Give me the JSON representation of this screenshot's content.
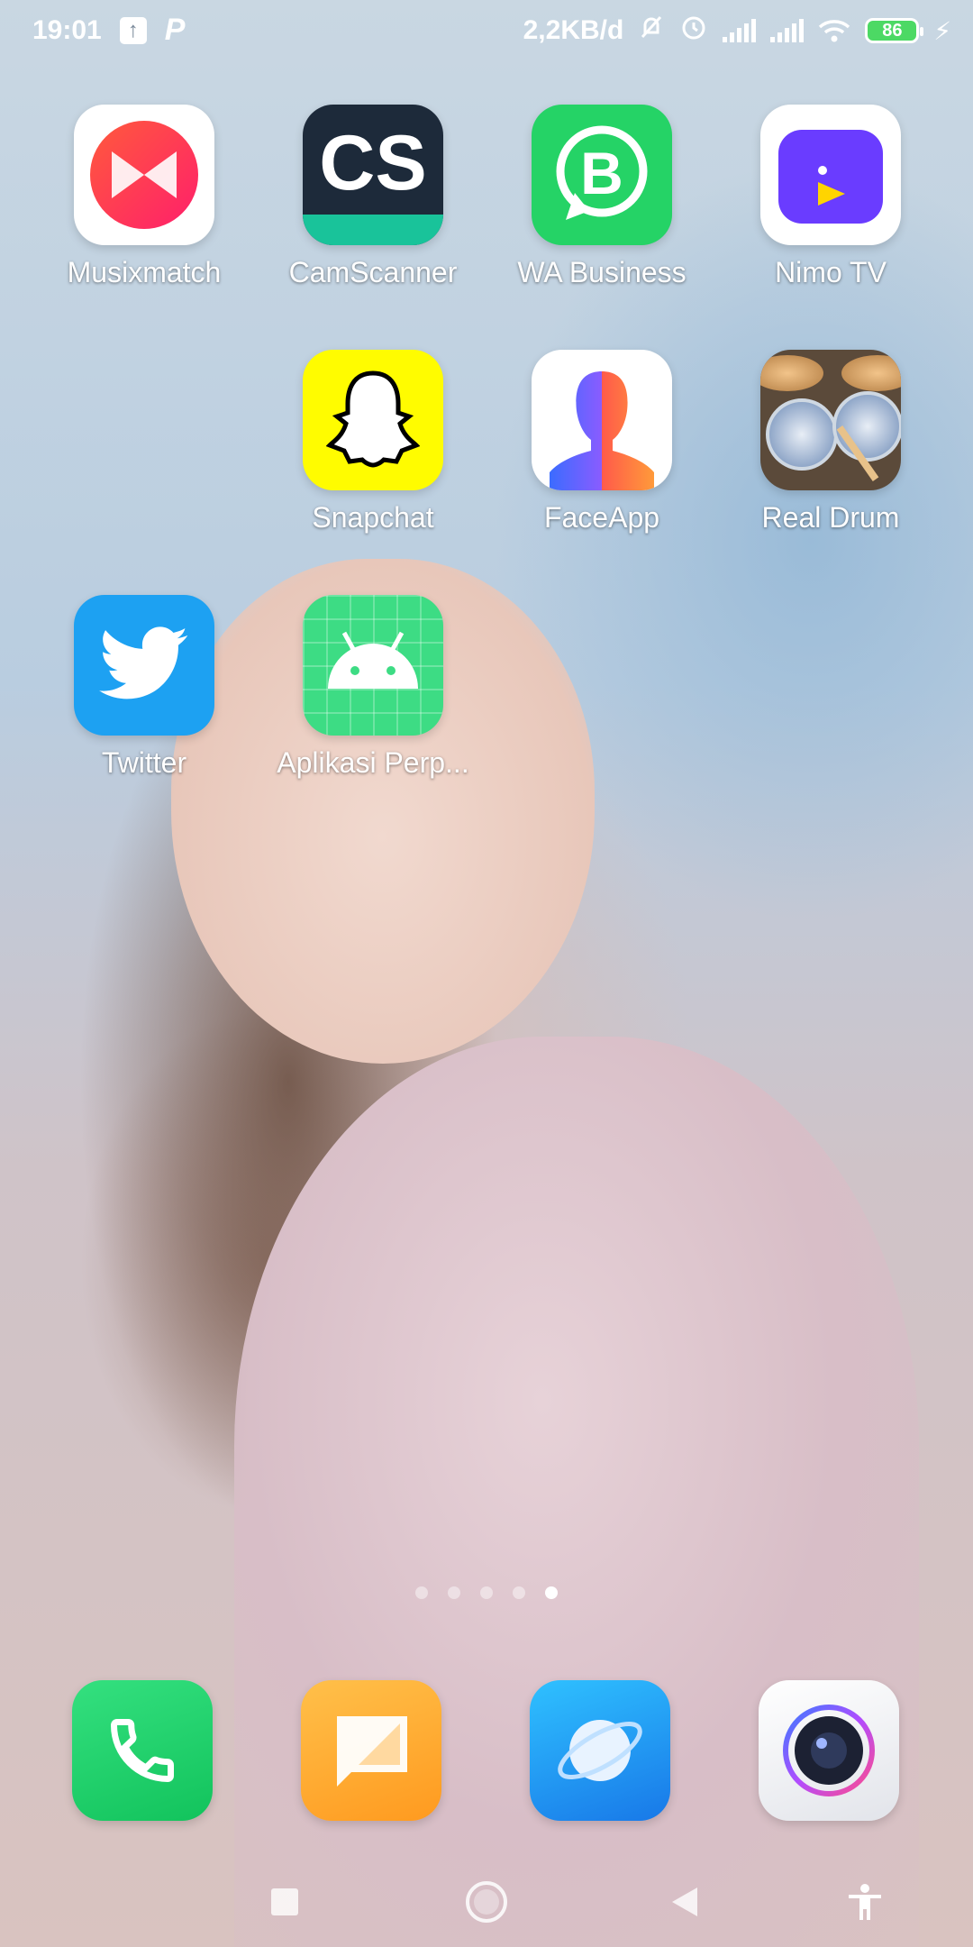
{
  "status_bar": {
    "time": "19:01",
    "net_speed": "2,2KB/d",
    "battery_level": "86",
    "icons": [
      "upload-icon",
      "p-icon",
      "mute-icon",
      "alarm-icon",
      "signal-icon",
      "signal-icon",
      "wifi-icon",
      "battery-icon",
      "charging-icon"
    ]
  },
  "apps": [
    {
      "label": "Musixmatch",
      "icon": "musixmatch-icon"
    },
    {
      "label": "CamScanner",
      "icon": "camscanner-icon",
      "glyph": "CS"
    },
    {
      "label": "WA Business",
      "icon": "whatsapp-business-icon",
      "glyph": "B"
    },
    {
      "label": "Nimo TV",
      "icon": "nimo-tv-icon"
    },
    {
      "label": "Snapchat",
      "icon": "snapchat-icon"
    },
    {
      "label": "FaceApp",
      "icon": "faceapp-icon"
    },
    {
      "label": "Real Drum",
      "icon": "real-drum-icon"
    },
    {
      "label": "Twitter",
      "icon": "twitter-icon"
    },
    {
      "label": "Aplikasi Perp...",
      "icon": "android-icon"
    }
  ],
  "pager": {
    "total": 5,
    "active_index": 4
  },
  "dock": [
    {
      "icon": "phone-icon"
    },
    {
      "icon": "messaging-icon"
    },
    {
      "icon": "browser-icon"
    },
    {
      "icon": "camera-icon"
    }
  ],
  "nav": [
    "recents-button",
    "home-button",
    "back-button",
    "accessibility-button"
  ],
  "colors": {
    "musixmatch": "#ff3f5b",
    "camscanner": "#1d2a3a",
    "camscanner_accent": "#19c39a",
    "whatsapp": "#25d366",
    "nimo": "#6a3cff",
    "snapchat": "#fffc00",
    "twitter": "#1da1f2",
    "android_bg": "#3ddc84",
    "phone": "#20d36b",
    "messaging": "#ffa726",
    "browser": "#1e88e5"
  }
}
